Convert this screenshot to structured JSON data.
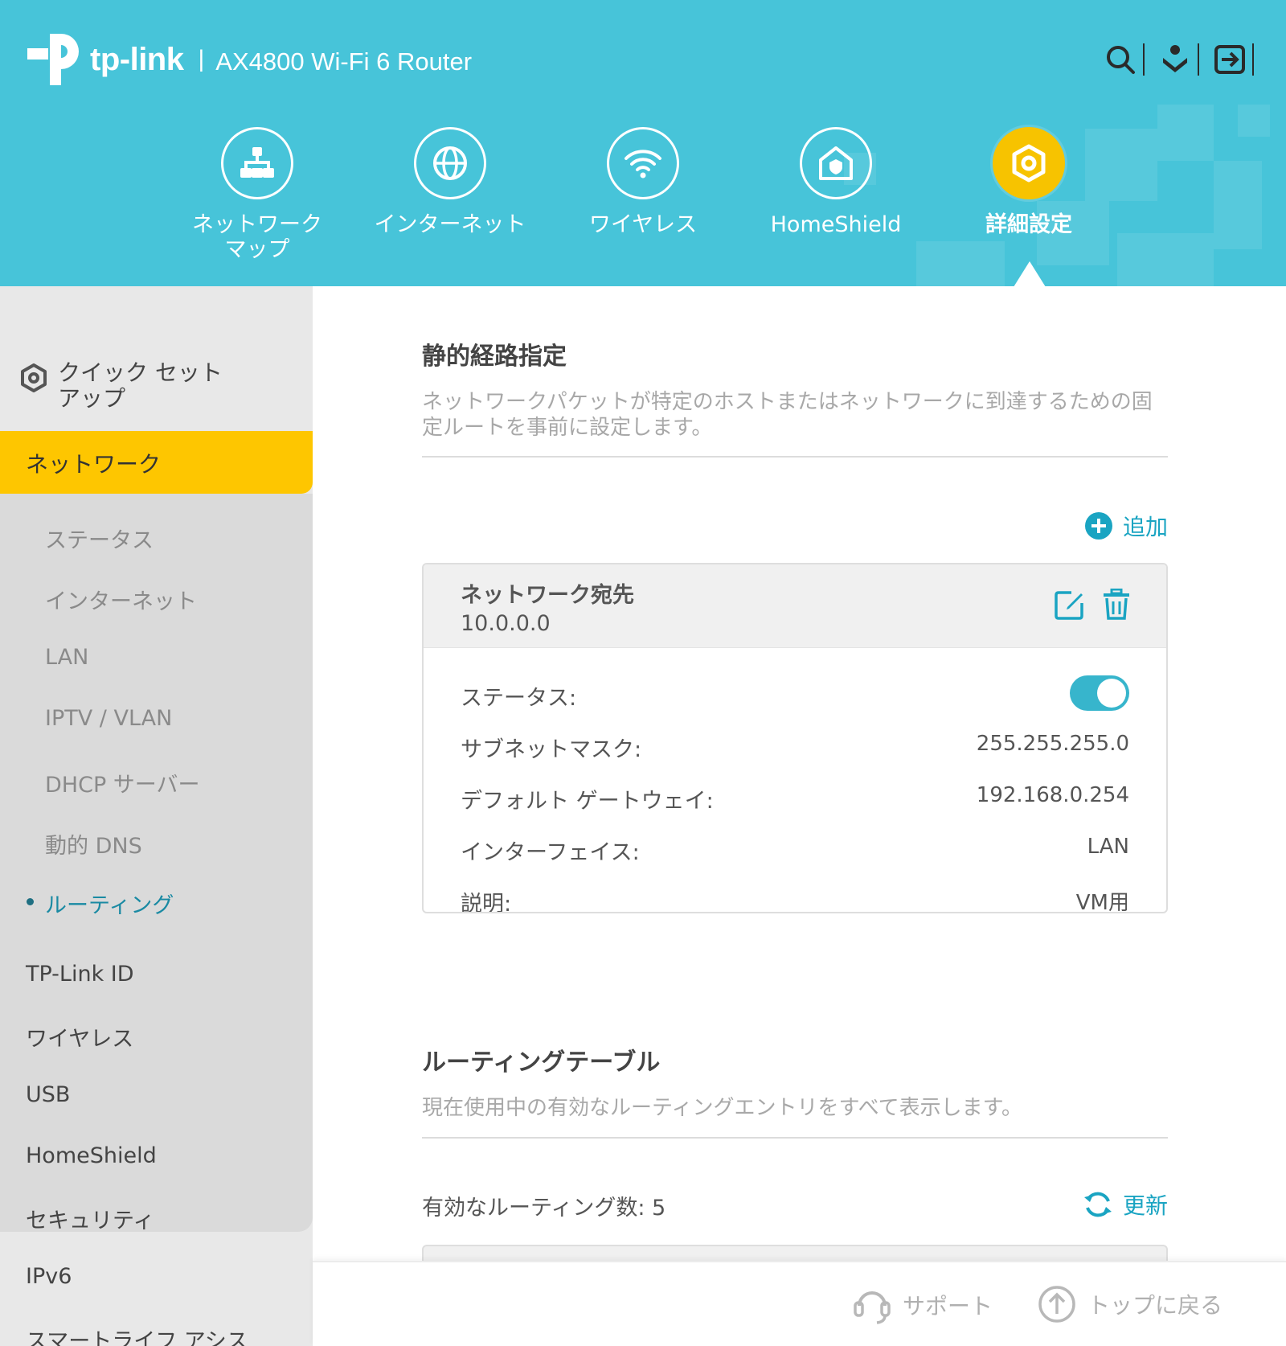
{
  "header": {
    "brand": "tp-link",
    "separator": "|",
    "model": "AX4800 Wi-Fi 6 Router",
    "icons": [
      "search-icon",
      "download-app-icon",
      "logout-icon"
    ]
  },
  "nav": {
    "items": [
      {
        "label": "ネットワーク\nマップ",
        "icon": "network-map-icon"
      },
      {
        "label": "インターネット",
        "icon": "globe-icon"
      },
      {
        "label": "ワイヤレス",
        "icon": "wifi-icon"
      },
      {
        "label": "HomeShield",
        "icon": "homeshield-icon"
      },
      {
        "label": "詳細設定",
        "icon": "gear-icon",
        "active": true
      }
    ]
  },
  "sidebar": {
    "quick_setup": "クイック セット\nアップ",
    "active": "ネットワーク",
    "sub_items": [
      "ステータス",
      "インターネット",
      "LAN",
      "IPTV / VLAN",
      "DHCP サーバー",
      "動的 DNS",
      "ルーティング"
    ],
    "current_sub": "ルーティング",
    "items": [
      "TP-Link ID",
      "ワイヤレス",
      "USB",
      "HomeShield",
      "セキュリティ",
      "IPv6",
      "スマートライフ アシス"
    ]
  },
  "static_routing": {
    "title": "静的経路指定",
    "description": "ネットワークパケットが特定のホストまたはネットワークに到達するための固定ルートを事前に設定します。",
    "add_label": "追加",
    "entry": {
      "dest_label": "ネットワーク宛先",
      "dest_value": "10.0.0.0",
      "status_label": "ステータス:",
      "status_on": true,
      "subnet_label": "サブネットマスク:",
      "subnet_value": "255.255.255.0",
      "gateway_label": "デフォルト ゲートウェイ:",
      "gateway_value": "192.168.0.254",
      "interface_label": "インターフェイス:",
      "interface_value": "LAN",
      "desc_label": "説明:",
      "desc_value": "VM用"
    }
  },
  "routing_table": {
    "title": "ルーティングテーブル",
    "description": "現在使用中の有効なルーティングエントリをすべて表示します。",
    "count_label": "有効なルーティング数: 5",
    "refresh_label": "更新"
  },
  "footer": {
    "support": "サポート",
    "back_to_top": "トップに戻る"
  },
  "colors": {
    "header_bg": "#47c4d9",
    "accent": "#fec600",
    "link": "#1aa4c2"
  }
}
